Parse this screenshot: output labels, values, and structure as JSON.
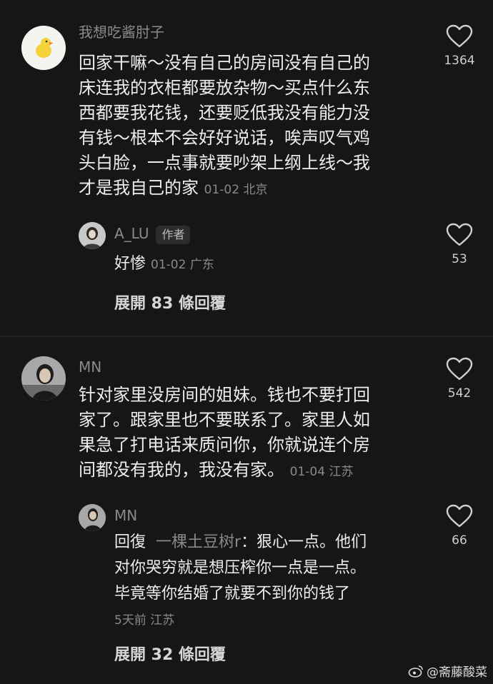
{
  "comments": [
    {
      "username": "我想吃酱肘子",
      "lines": [
        "回家干嘛～没有自己的房间没有自己的",
        "床连我的衣柜都要放杂物～买点什么东",
        "西都要我花钱，还要贬低我没有能力没",
        "有钱～根本不会好好说话，唉声叹气鸡",
        "头白脸，一点事就要吵架上纲上线～我",
        "才是我自己的家"
      ],
      "meta": "01-02 北京",
      "likes": "1364",
      "reply": {
        "username": "A_LU",
        "badge": "作者",
        "text": "好惨",
        "meta": "01-02 广东",
        "likes": "53"
      },
      "expand": "展開 83 條回覆"
    },
    {
      "username": "MN",
      "lines": [
        "针对家里没房间的姐妹。钱也不要打回",
        "家了。跟家里也不要联系了。家里人如",
        "果急了打电话来质问你，你就说连个房",
        "间都没有我的，我没有家。"
      ],
      "meta": "01-04 江苏",
      "likes": "542",
      "reply": {
        "username": "MN",
        "prefix": "回復",
        "handle": "一棵土豆树r",
        "lines": [
          "：狠心一点。他们",
          "对你哭穷就是想压榨你一点是一点。",
          "毕竟等你结婚了就要不到你的钱了"
        ],
        "meta": "5天前 江苏",
        "likes": "66"
      },
      "expand": "展開 32 條回覆"
    }
  ],
  "watermark": "@斋藤酸菜",
  "colors": {
    "background": "#161616",
    "muted": "#8a8a8a",
    "text": "#ededed"
  }
}
